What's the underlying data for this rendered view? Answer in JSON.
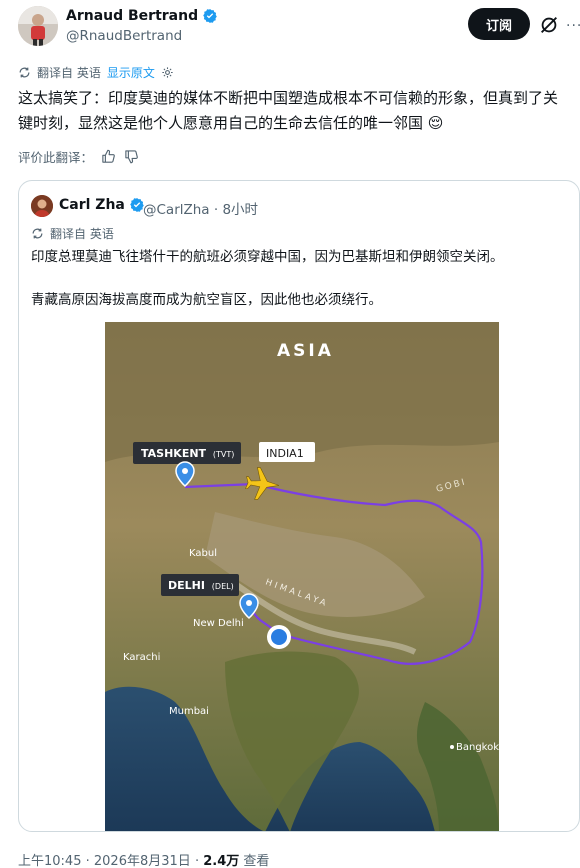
{
  "author": {
    "name": "Arnaud Bertrand",
    "handle": "@RnaudBertrand",
    "subscribe_label": "订阅"
  },
  "translation": {
    "label": "翻译自 英语",
    "show_original": "显示原文"
  },
  "tweet": {
    "text": "这太搞笑了：印度莫迪的媒体不断把中国塑造成根本不可信赖的形象，但真到了关键时刻，显然这是他个人愿意用自己的生命去信任的唯一邻国 😌"
  },
  "rate": {
    "label": "评价此翻译："
  },
  "quoted": {
    "name": "Carl Zha",
    "handle": "@CarlZha",
    "separator": "·",
    "time": "8小时",
    "translate_label": "翻译自 英语",
    "line1": "印度总理莫迪飞往塔什干的航班必须穿越中国，因为巴基斯坦和伊朗领空关闭。",
    "line2": "青藏高原因海拔高度而成为航空盲区，因此他也必须绕行。"
  },
  "map": {
    "region_label": "ASIA",
    "tashkent_label": "TASHKENT",
    "tashkent_code": "(TVT)",
    "flight_label": "INDIA1",
    "delhi_label": "DELHI",
    "delhi_code": "(DEL)",
    "gobi": "GOBI",
    "himalaya": "HIMALAYA",
    "kabul": "Kabul",
    "new_delhi": "New Delhi",
    "karachi": "Karachi",
    "mumbai": "Mumbai",
    "bangkok": "Bangkok",
    "colors": {
      "route": "#7b3fe4",
      "plane": "#f5c518",
      "pin": "#3a8ee6",
      "current": "#2a7de1"
    }
  },
  "footer": {
    "time": "上午10:45",
    "separator": "·",
    "date": "2026年8月31日",
    "separator2": "·",
    "views": "2.4万",
    "views_label": "查看"
  }
}
